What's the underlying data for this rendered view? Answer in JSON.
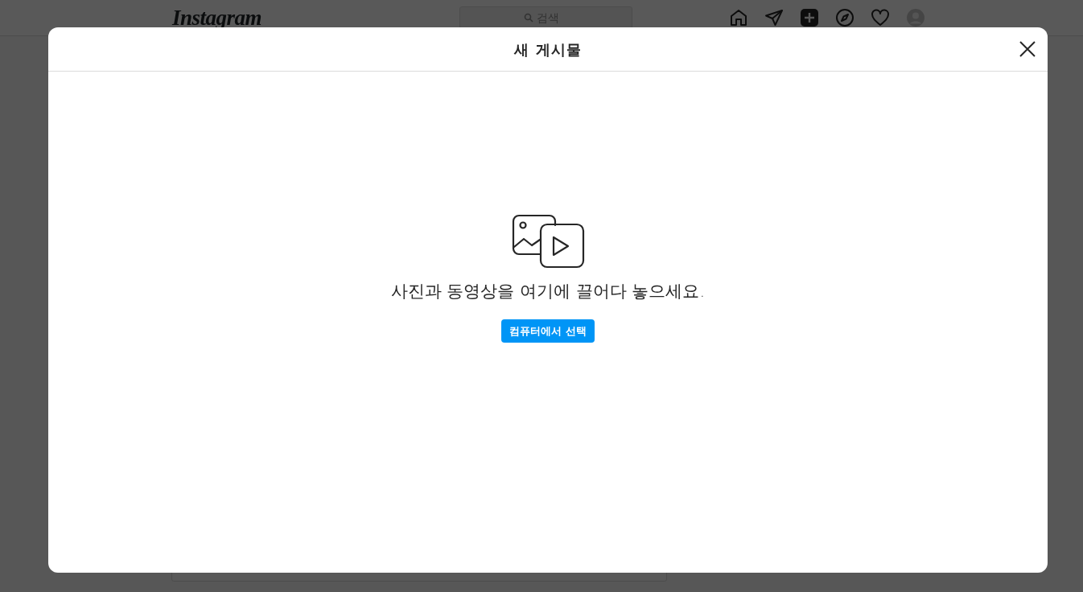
{
  "navbar": {
    "logo": "Instagram",
    "search": {
      "placeholder": "검색"
    },
    "icons": [
      {
        "kind": "home",
        "selected": false
      },
      {
        "kind": "direct",
        "selected": false
      },
      {
        "kind": "new-post",
        "selected": true
      },
      {
        "kind": "explore",
        "selected": false
      },
      {
        "kind": "activity",
        "selected": false
      },
      {
        "kind": "profile",
        "selected": false
      }
    ]
  },
  "modal": {
    "title": "새 게시물",
    "message": "사진과 동영상을 여기에 끌어다 놓으세요.",
    "button": "컴퓨터에서 선택"
  }
}
